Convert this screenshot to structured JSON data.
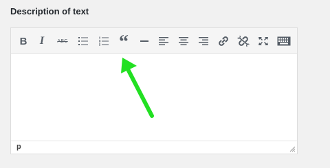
{
  "field": {
    "label": "Description of text"
  },
  "toolbar": {
    "buttons": [
      {
        "name": "bold",
        "label": "B"
      },
      {
        "name": "italic",
        "label": "I"
      },
      {
        "name": "strikethrough",
        "label": "ABC"
      },
      {
        "name": "bulleted-list"
      },
      {
        "name": "numbered-list"
      },
      {
        "name": "blockquote",
        "label": "“"
      },
      {
        "name": "horizontal-line"
      },
      {
        "name": "align-left"
      },
      {
        "name": "align-center"
      },
      {
        "name": "align-right"
      },
      {
        "name": "insert-link"
      },
      {
        "name": "remove-link"
      },
      {
        "name": "fullscreen"
      },
      {
        "name": "toolbar-toggle"
      }
    ]
  },
  "editor": {
    "content": ""
  },
  "statusbar": {
    "path": "p"
  },
  "colors": {
    "icon": "#555d66",
    "annotation_arrow": "#22e022"
  }
}
